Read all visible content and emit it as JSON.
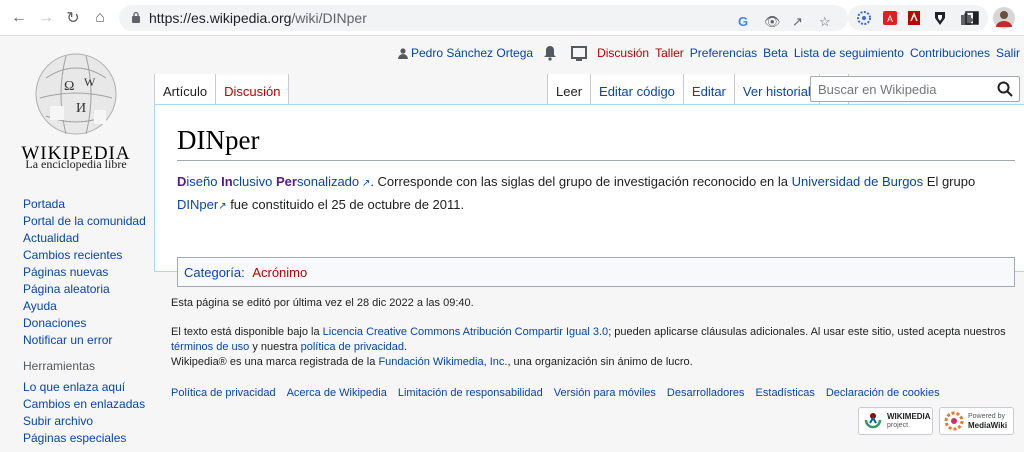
{
  "browser": {
    "url_host": "https://es.wikipedia.org",
    "url_path": "/wiki/DINper"
  },
  "header": {
    "user": "Pedro Sánchez Ortega",
    "links": [
      "Discusión",
      "Taller",
      "Preferencias",
      "Beta",
      "Lista de seguimiento",
      "Contribuciones",
      "Salir"
    ]
  },
  "logo": {
    "wordmark": "WIKIPEDIA",
    "tagline": "La enciclopedia libre"
  },
  "sidebar": {
    "nav": [
      "Portada",
      "Portal de la comunidad",
      "Actualidad",
      "Cambios recientes",
      "Páginas nuevas",
      "Página aleatoria",
      "Ayuda",
      "Donaciones",
      "Notificar un error"
    ],
    "tools_heading": "Herramientas",
    "tools": [
      "Lo que enlaza aquí",
      "Cambios en enlazadas",
      "Subir archivo",
      "Páginas especiales"
    ]
  },
  "tabs": {
    "left": [
      "Artículo",
      "Discusión"
    ],
    "right": [
      "Leer",
      "Editar código",
      "Editar",
      "Ver historial"
    ]
  },
  "search": {
    "placeholder": "Buscar en Wikipedia"
  },
  "article": {
    "title": "DINper",
    "acronym_parts": [
      {
        "bold": "D",
        "rest": "iseño "
      },
      {
        "bold": "In",
        "rest": "clusivo "
      },
      {
        "bold": "Per",
        "rest": "sonalizado"
      }
    ],
    "text1": ". Corresponde con las siglas del grupo de investigación reconocido en la ",
    "link_university": "Universidad de Burgos",
    "text2": " El grupo ",
    "link_dinper": "DINper",
    "text3": " fue constituido el 25 de octubre de 2011.",
    "category_label": "Categoría:",
    "category": "Acrónimo"
  },
  "footer": {
    "last_edit": "Esta página se editó por última vez el 28 dic 2022 a las 09:40.",
    "license_pre": "El texto está disponible bajo la ",
    "license_link": "Licencia Creative Commons Atribución Compartir Igual 3.0",
    "license_mid": "; pueden aplicarse cláusulas adicionales. Al usar este sitio, usted acepta nuestros ",
    "terms_link": "términos de uso",
    "license_and": " y nuestra ",
    "privacy_link": "política de privacidad",
    "license_end": ".",
    "trademark_pre": "Wikipedia® es una marca registrada de la ",
    "trademark_link": "Fundación Wikimedia, Inc.",
    "trademark_post": ", una organización sin ánimo de lucro.",
    "links": [
      "Política de privacidad",
      "Acerca de Wikipedia",
      "Limitación de responsabilidad",
      "Versión para móviles",
      "Desarrolladores",
      "Estadísticas",
      "Declaración de cookies"
    ],
    "badge1_title": "WIKIMEDIA",
    "badge1_sub": "project",
    "badge2_title": "Powered by",
    "badge2_sub": "MediaWiki"
  }
}
